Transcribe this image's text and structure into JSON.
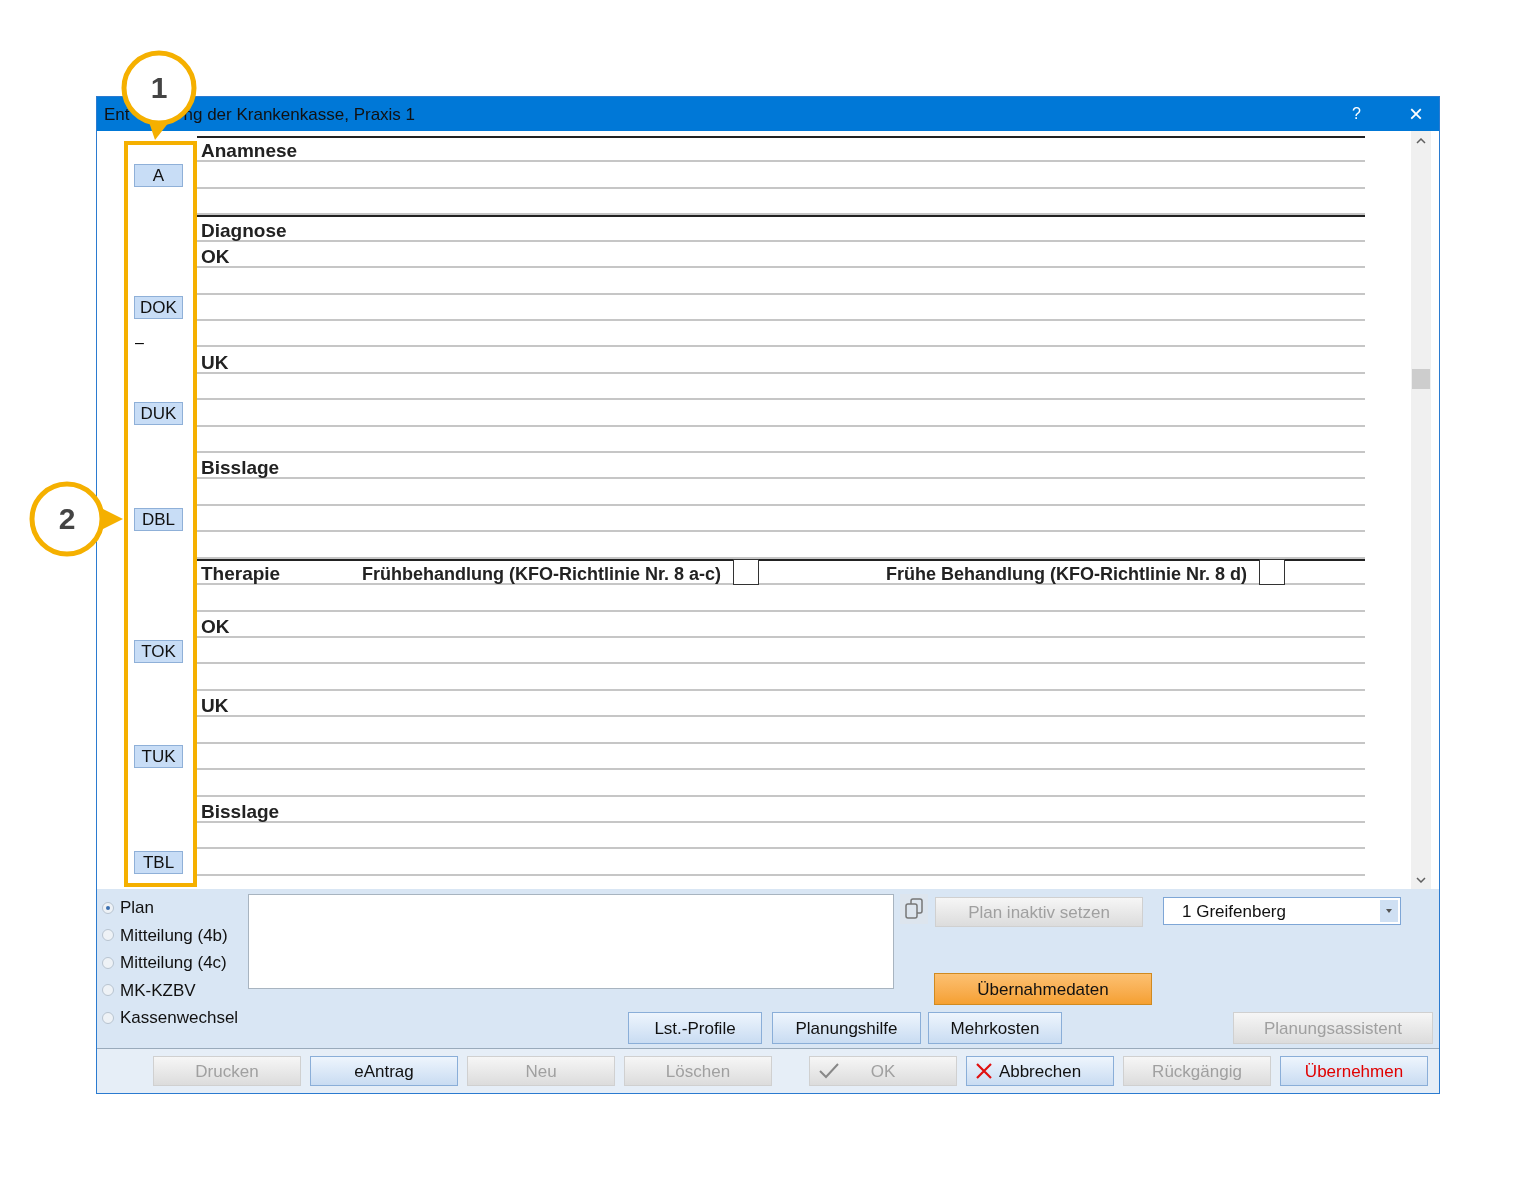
{
  "window": {
    "title_parts": [
      "Ent",
      "ng der Krankenkasse, Praxis 1"
    ],
    "help": "?",
    "close": "×"
  },
  "form_rows": [
    {
      "label": "Anamnese",
      "heavy_rule": true
    },
    {
      "button": "A",
      "heavy_rule": false
    },
    {
      "heavy_rule": false
    },
    {
      "label": "Diagnose",
      "heavy_rule": true
    },
    {
      "label": "OK",
      "heavy_rule": false
    },
    {
      "heavy_rule": false
    },
    {
      "button": "DOK",
      "heavy_rule": false
    },
    {
      "heavy_rule": false
    },
    {
      "label": "UK",
      "marker": "–",
      "heavy_rule": false
    },
    {
      "heavy_rule": false
    },
    {
      "button": "DUK",
      "heavy_rule": false
    },
    {
      "heavy_rule": false
    },
    {
      "label": "Bisslage",
      "heavy_rule": false
    },
    {
      "heavy_rule": false
    },
    {
      "button": "DBL",
      "heavy_rule": false
    },
    {
      "heavy_rule": false
    },
    {
      "label": "Therapie",
      "heavy_rule": true,
      "options": [
        {
          "label": "Frühbehandlung (KFO-Richtlinie Nr. 8 a-c)",
          "checked": false
        },
        {
          "label": "Frühe Behandlung (KFO-Richtlinie Nr. 8 d)",
          "checked": false
        }
      ]
    },
    {
      "heavy_rule": false
    },
    {
      "label": "OK",
      "heavy_rule": false
    },
    {
      "button": "TOK",
      "heavy_rule": false
    },
    {
      "heavy_rule": false
    },
    {
      "label": "UK",
      "heavy_rule": false
    },
    {
      "heavy_rule": false
    },
    {
      "button": "TUK",
      "heavy_rule": false
    },
    {
      "heavy_rule": false
    },
    {
      "label": "Bisslage",
      "heavy_rule": false
    },
    {
      "heavy_rule": false
    },
    {
      "button": "TBL",
      "heavy_rule": false
    }
  ],
  "annotations": [
    {
      "number": "1"
    },
    {
      "number": "2"
    }
  ],
  "bottom": {
    "document_types": [
      {
        "label": "Plan",
        "selected": true
      },
      {
        "label": "Mitteilung (4b)",
        "selected": false
      },
      {
        "label": "Mitteilung (4c)",
        "selected": false
      },
      {
        "label": "MK-KZBV",
        "selected": false
      },
      {
        "label": "Kassenwechsel",
        "selected": false
      }
    ],
    "inactivate_button": {
      "label": "Plan inaktiv setzen",
      "disabled": true
    },
    "location_select": {
      "value": "1 Greifenberg"
    },
    "transfer_button": {
      "label": "Übernahmedaten"
    },
    "tool_buttons": [
      {
        "label": "Lst.-Profile",
        "disabled": false
      },
      {
        "label": "Planungshilfe",
        "disabled": false
      },
      {
        "label": "Mehrkosten",
        "disabled": false
      }
    ],
    "assistant_button": {
      "label": "Planungsassistent",
      "disabled": true
    }
  },
  "footer_buttons": [
    {
      "label": "Drucken",
      "disabled": true,
      "kind": "plain"
    },
    {
      "label": "eAntrag",
      "disabled": false,
      "kind": "plain"
    },
    {
      "label": "Neu",
      "disabled": true,
      "kind": "plain"
    },
    {
      "label": "Löschen",
      "disabled": true,
      "kind": "plain"
    },
    {
      "label": "OK",
      "disabled": true,
      "kind": "confirm"
    },
    {
      "label": "Abbrechen",
      "disabled": false,
      "kind": "cancel"
    },
    {
      "label": "Rückgängig",
      "disabled": true,
      "kind": "plain"
    },
    {
      "label": "Übernehmen",
      "disabled": false,
      "kind": "apply"
    }
  ]
}
